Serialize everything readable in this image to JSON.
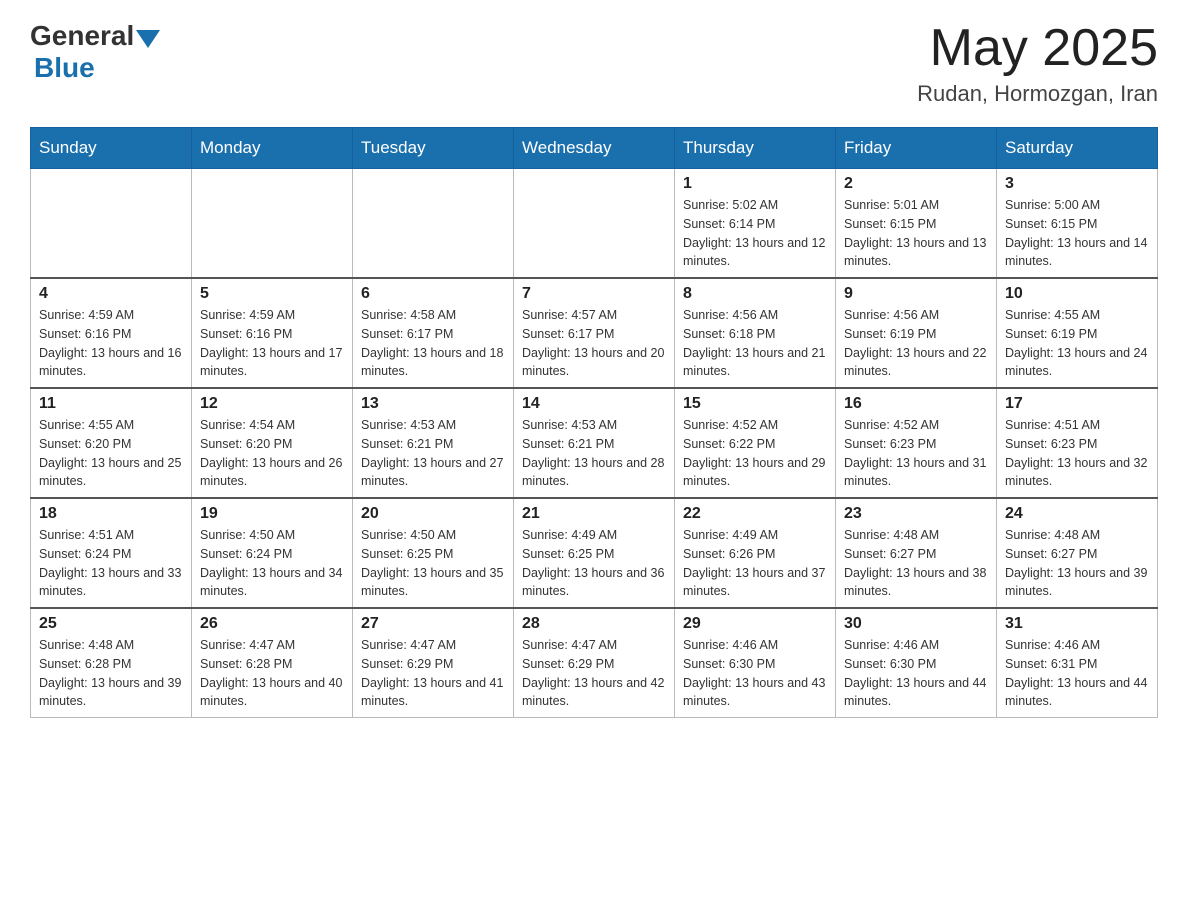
{
  "header": {
    "logo_general": "General",
    "logo_blue": "Blue",
    "month_year": "May 2025",
    "location": "Rudan, Hormozgan, Iran"
  },
  "days_of_week": [
    "Sunday",
    "Monday",
    "Tuesday",
    "Wednesday",
    "Thursday",
    "Friday",
    "Saturday"
  ],
  "weeks": [
    [
      {
        "day": "",
        "info": ""
      },
      {
        "day": "",
        "info": ""
      },
      {
        "day": "",
        "info": ""
      },
      {
        "day": "",
        "info": ""
      },
      {
        "day": "1",
        "info": "Sunrise: 5:02 AM\nSunset: 6:14 PM\nDaylight: 13 hours and 12 minutes."
      },
      {
        "day": "2",
        "info": "Sunrise: 5:01 AM\nSunset: 6:15 PM\nDaylight: 13 hours and 13 minutes."
      },
      {
        "day": "3",
        "info": "Sunrise: 5:00 AM\nSunset: 6:15 PM\nDaylight: 13 hours and 14 minutes."
      }
    ],
    [
      {
        "day": "4",
        "info": "Sunrise: 4:59 AM\nSunset: 6:16 PM\nDaylight: 13 hours and 16 minutes."
      },
      {
        "day": "5",
        "info": "Sunrise: 4:59 AM\nSunset: 6:16 PM\nDaylight: 13 hours and 17 minutes."
      },
      {
        "day": "6",
        "info": "Sunrise: 4:58 AM\nSunset: 6:17 PM\nDaylight: 13 hours and 18 minutes."
      },
      {
        "day": "7",
        "info": "Sunrise: 4:57 AM\nSunset: 6:17 PM\nDaylight: 13 hours and 20 minutes."
      },
      {
        "day": "8",
        "info": "Sunrise: 4:56 AM\nSunset: 6:18 PM\nDaylight: 13 hours and 21 minutes."
      },
      {
        "day": "9",
        "info": "Sunrise: 4:56 AM\nSunset: 6:19 PM\nDaylight: 13 hours and 22 minutes."
      },
      {
        "day": "10",
        "info": "Sunrise: 4:55 AM\nSunset: 6:19 PM\nDaylight: 13 hours and 24 minutes."
      }
    ],
    [
      {
        "day": "11",
        "info": "Sunrise: 4:55 AM\nSunset: 6:20 PM\nDaylight: 13 hours and 25 minutes."
      },
      {
        "day": "12",
        "info": "Sunrise: 4:54 AM\nSunset: 6:20 PM\nDaylight: 13 hours and 26 minutes."
      },
      {
        "day": "13",
        "info": "Sunrise: 4:53 AM\nSunset: 6:21 PM\nDaylight: 13 hours and 27 minutes."
      },
      {
        "day": "14",
        "info": "Sunrise: 4:53 AM\nSunset: 6:21 PM\nDaylight: 13 hours and 28 minutes."
      },
      {
        "day": "15",
        "info": "Sunrise: 4:52 AM\nSunset: 6:22 PM\nDaylight: 13 hours and 29 minutes."
      },
      {
        "day": "16",
        "info": "Sunrise: 4:52 AM\nSunset: 6:23 PM\nDaylight: 13 hours and 31 minutes."
      },
      {
        "day": "17",
        "info": "Sunrise: 4:51 AM\nSunset: 6:23 PM\nDaylight: 13 hours and 32 minutes."
      }
    ],
    [
      {
        "day": "18",
        "info": "Sunrise: 4:51 AM\nSunset: 6:24 PM\nDaylight: 13 hours and 33 minutes."
      },
      {
        "day": "19",
        "info": "Sunrise: 4:50 AM\nSunset: 6:24 PM\nDaylight: 13 hours and 34 minutes."
      },
      {
        "day": "20",
        "info": "Sunrise: 4:50 AM\nSunset: 6:25 PM\nDaylight: 13 hours and 35 minutes."
      },
      {
        "day": "21",
        "info": "Sunrise: 4:49 AM\nSunset: 6:25 PM\nDaylight: 13 hours and 36 minutes."
      },
      {
        "day": "22",
        "info": "Sunrise: 4:49 AM\nSunset: 6:26 PM\nDaylight: 13 hours and 37 minutes."
      },
      {
        "day": "23",
        "info": "Sunrise: 4:48 AM\nSunset: 6:27 PM\nDaylight: 13 hours and 38 minutes."
      },
      {
        "day": "24",
        "info": "Sunrise: 4:48 AM\nSunset: 6:27 PM\nDaylight: 13 hours and 39 minutes."
      }
    ],
    [
      {
        "day": "25",
        "info": "Sunrise: 4:48 AM\nSunset: 6:28 PM\nDaylight: 13 hours and 39 minutes."
      },
      {
        "day": "26",
        "info": "Sunrise: 4:47 AM\nSunset: 6:28 PM\nDaylight: 13 hours and 40 minutes."
      },
      {
        "day": "27",
        "info": "Sunrise: 4:47 AM\nSunset: 6:29 PM\nDaylight: 13 hours and 41 minutes."
      },
      {
        "day": "28",
        "info": "Sunrise: 4:47 AM\nSunset: 6:29 PM\nDaylight: 13 hours and 42 minutes."
      },
      {
        "day": "29",
        "info": "Sunrise: 4:46 AM\nSunset: 6:30 PM\nDaylight: 13 hours and 43 minutes."
      },
      {
        "day": "30",
        "info": "Sunrise: 4:46 AM\nSunset: 6:30 PM\nDaylight: 13 hours and 44 minutes."
      },
      {
        "day": "31",
        "info": "Sunrise: 4:46 AM\nSunset: 6:31 PM\nDaylight: 13 hours and 44 minutes."
      }
    ]
  ]
}
